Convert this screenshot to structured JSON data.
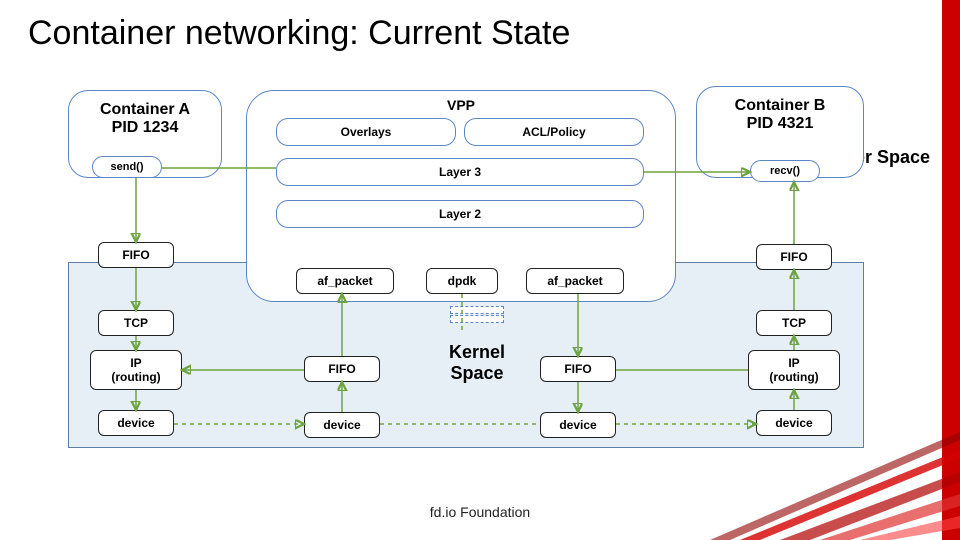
{
  "title": "Container networking: Current State",
  "footer": "fd.io Foundation",
  "labels": {
    "user_space": "User Space",
    "kernel_space": "Kernel Space",
    "vpp": "VPP"
  },
  "container_a": {
    "title": "Container A",
    "pid": "PID 1234",
    "call": "send()"
  },
  "container_b": {
    "title": "Container B",
    "pid": "PID 4321",
    "call": "recv()"
  },
  "vpp_boxes": {
    "overlays": "Overlays",
    "acl": "ACL/Policy",
    "l3": "Layer 3",
    "l2": "Layer 2",
    "afpkt_l": "af_packet",
    "dpdk": "dpdk",
    "afpkt_r": "af_packet"
  },
  "left_stack": {
    "fifo": "FIFO",
    "tcp": "TCP",
    "ip": "IP\n(routing)",
    "device": "device"
  },
  "right_stack": {
    "fifo": "FIFO",
    "tcp": "TCP",
    "ip": "IP\n(routing)",
    "device": "device"
  },
  "mid_stack": {
    "fifo_l": "FIFO",
    "device_l": "device",
    "fifo_r": "FIFO",
    "device_r": "device"
  }
}
